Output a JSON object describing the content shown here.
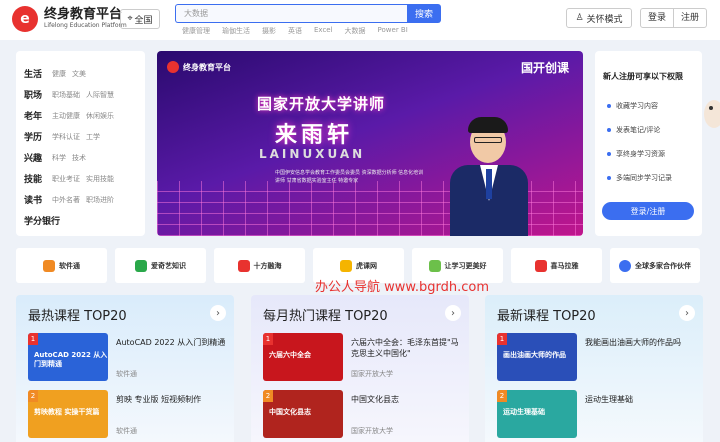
{
  "header": {
    "logo_mark": "e",
    "logo_cn": "终身教育平台",
    "logo_en": "Lifelong Education Platform",
    "region": "全国",
    "search_placeholder": "大数据",
    "search_button": "搜索",
    "hot_words": [
      "健康管理",
      "瑜伽生活",
      "摄影",
      "英语",
      "Excel",
      "大数据",
      "Power BI"
    ],
    "care_mode": "关怀模式",
    "login": "登录",
    "register": "注册"
  },
  "categories": [
    {
      "name": "生活",
      "subs": [
        "健康",
        "文美"
      ]
    },
    {
      "name": "职场",
      "subs": [
        "职场基础",
        "人际智慧"
      ]
    },
    {
      "name": "老年",
      "subs": [
        "主动健康",
        "休闲娱乐"
      ]
    },
    {
      "name": "学历",
      "subs": [
        "学科认证",
        "工学"
      ]
    },
    {
      "name": "兴趣",
      "subs": [
        "科学",
        "技术"
      ]
    },
    {
      "name": "技能",
      "subs": [
        "职业考证",
        "实用技能"
      ]
    },
    {
      "name": "读书",
      "subs": [
        "中外名著",
        "职场进阶"
      ]
    },
    {
      "name": "学分银行",
      "subs": []
    }
  ],
  "banner": {
    "logo": "终身教育平台",
    "brand": "国开创课",
    "title": "国家开放大学讲师",
    "name": "来雨轩",
    "pinyin": "LAINUXUAN",
    "info": "中国伊安信息学会教育工作委员会委员 资深数据分析师 信息化培训讲师 甘肃省数据实验室主任 特邀专家"
  },
  "register_panel": {
    "title": "新人注册可享以下权限",
    "items": [
      "收藏学习内容",
      "发表笔记/评论",
      "享终身学习资源",
      "多端同步学习记录"
    ],
    "button": "登录/注册"
  },
  "partners": [
    {
      "name": "软件通",
      "color": "#f08a24"
    },
    {
      "name": "爱奇艺知识",
      "color": "#2aa84a"
    },
    {
      "name": "十方融海",
      "color": "#e8322f"
    },
    {
      "name": "虎课网",
      "color": "#f5b400"
    },
    {
      "name": "让学习更美好",
      "color": "#6cc04a"
    },
    {
      "name": "喜马拉雅",
      "color": "#e8322f"
    },
    {
      "name": "全球多家合作伙伴",
      "color": "#3b6ef0"
    }
  ],
  "watermark": "办公人导航 www.bgrdh.com",
  "columns": [
    {
      "title": "最热课程 TOP20",
      "bg": "#d9ecfb",
      "items": [
        {
          "rank": "1",
          "thumb_text": "AutoCAD 2022 从入门到精通",
          "thumb_color": "#2a63d8",
          "title": "AutoCAD 2022 从入门到精通",
          "sub": "软件通"
        },
        {
          "rank": "2",
          "thumb_text": "剪映教程 实操干货篇",
          "thumb_color": "#f0a020",
          "title": "剪映 专业版 短视频制作",
          "sub": "软件通"
        }
      ]
    },
    {
      "title": "每月热门课程 TOP20",
      "bg": "#e6e8fa",
      "items": [
        {
          "rank": "1",
          "thumb_text": "六届六中全会",
          "thumb_color": "#c8161d",
          "title": "六届六中全会：毛泽东首提\"马克思主义中国化\"",
          "sub": "国家开放大学"
        },
        {
          "rank": "2",
          "thumb_text": "中国文化县志",
          "thumb_color": "#b0241e",
          "title": "中国文化县志",
          "sub": "国家开放大学"
        }
      ]
    },
    {
      "title": "最新课程 TOP20",
      "bg": "#dbeefa",
      "items": [
        {
          "rank": "1",
          "thumb_text": "画出油画大师的作品",
          "thumb_color": "#2a4fb8",
          "title": "我能画出油画大师的作品吗",
          "sub": ""
        },
        {
          "rank": "2",
          "thumb_text": "运动生理基础",
          "thumb_color": "#2aa8a0",
          "title": "运动生理基础",
          "sub": ""
        }
      ]
    }
  ]
}
